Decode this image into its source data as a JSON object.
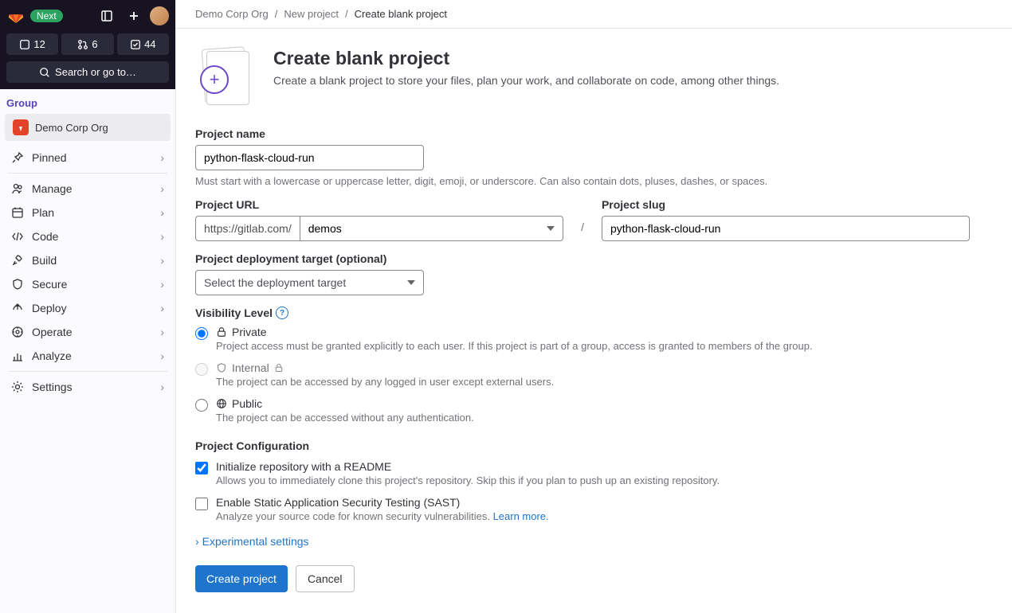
{
  "badge": "Next",
  "counters": {
    "issues": "12",
    "mrs": "6",
    "todos": "44"
  },
  "search_label": "Search or go to…",
  "sidebar": {
    "section_label": "Group",
    "group_name": "Demo Corp Org",
    "items": [
      {
        "label": "Pinned"
      },
      {
        "label": "Manage"
      },
      {
        "label": "Plan"
      },
      {
        "label": "Code"
      },
      {
        "label": "Build"
      },
      {
        "label": "Secure"
      },
      {
        "label": "Deploy"
      },
      {
        "label": "Operate"
      },
      {
        "label": "Analyze"
      },
      {
        "label": "Settings"
      }
    ]
  },
  "breadcrumbs": {
    "a": "Demo Corp Org",
    "b": "New project",
    "c": "Create blank project"
  },
  "page": {
    "title": "Create blank project",
    "subtitle": "Create a blank project to store your files, plan your work, and collaborate on code, among other things."
  },
  "form": {
    "project_name_label": "Project name",
    "project_name_value": "python-flask-cloud-run",
    "project_name_help": "Must start with a lowercase or uppercase letter, digit, emoji, or underscore. Can also contain dots, pluses, dashes, or spaces.",
    "project_url_label": "Project URL",
    "base_url": "https://gitlab.com/",
    "namespace": "demos",
    "slug_label": "Project slug",
    "slug_value": "python-flask-cloud-run",
    "deployment_label": "Project deployment target (optional)",
    "deployment_placeholder": "Select the deployment target",
    "visibility_label": "Visibility Level",
    "visibility": {
      "private": {
        "title": "Private",
        "desc": "Project access must be granted explicitly to each user. If this project is part of a group, access is granted to members of the group."
      },
      "internal": {
        "title": "Internal",
        "desc": "The project can be accessed by any logged in user except external users."
      },
      "public": {
        "title": "Public",
        "desc": "The project can be accessed without any authentication."
      }
    },
    "config_label": "Project Configuration",
    "readme": {
      "title": "Initialize repository with a README",
      "desc": "Allows you to immediately clone this project's repository. Skip this if you plan to push up an existing repository."
    },
    "sast": {
      "title": "Enable Static Application Security Testing (SAST)",
      "desc": "Analyze your source code for known security vulnerabilities. ",
      "learn_more": "Learn more."
    },
    "experimental": "Experimental settings",
    "create_btn": "Create project",
    "cancel_btn": "Cancel"
  }
}
